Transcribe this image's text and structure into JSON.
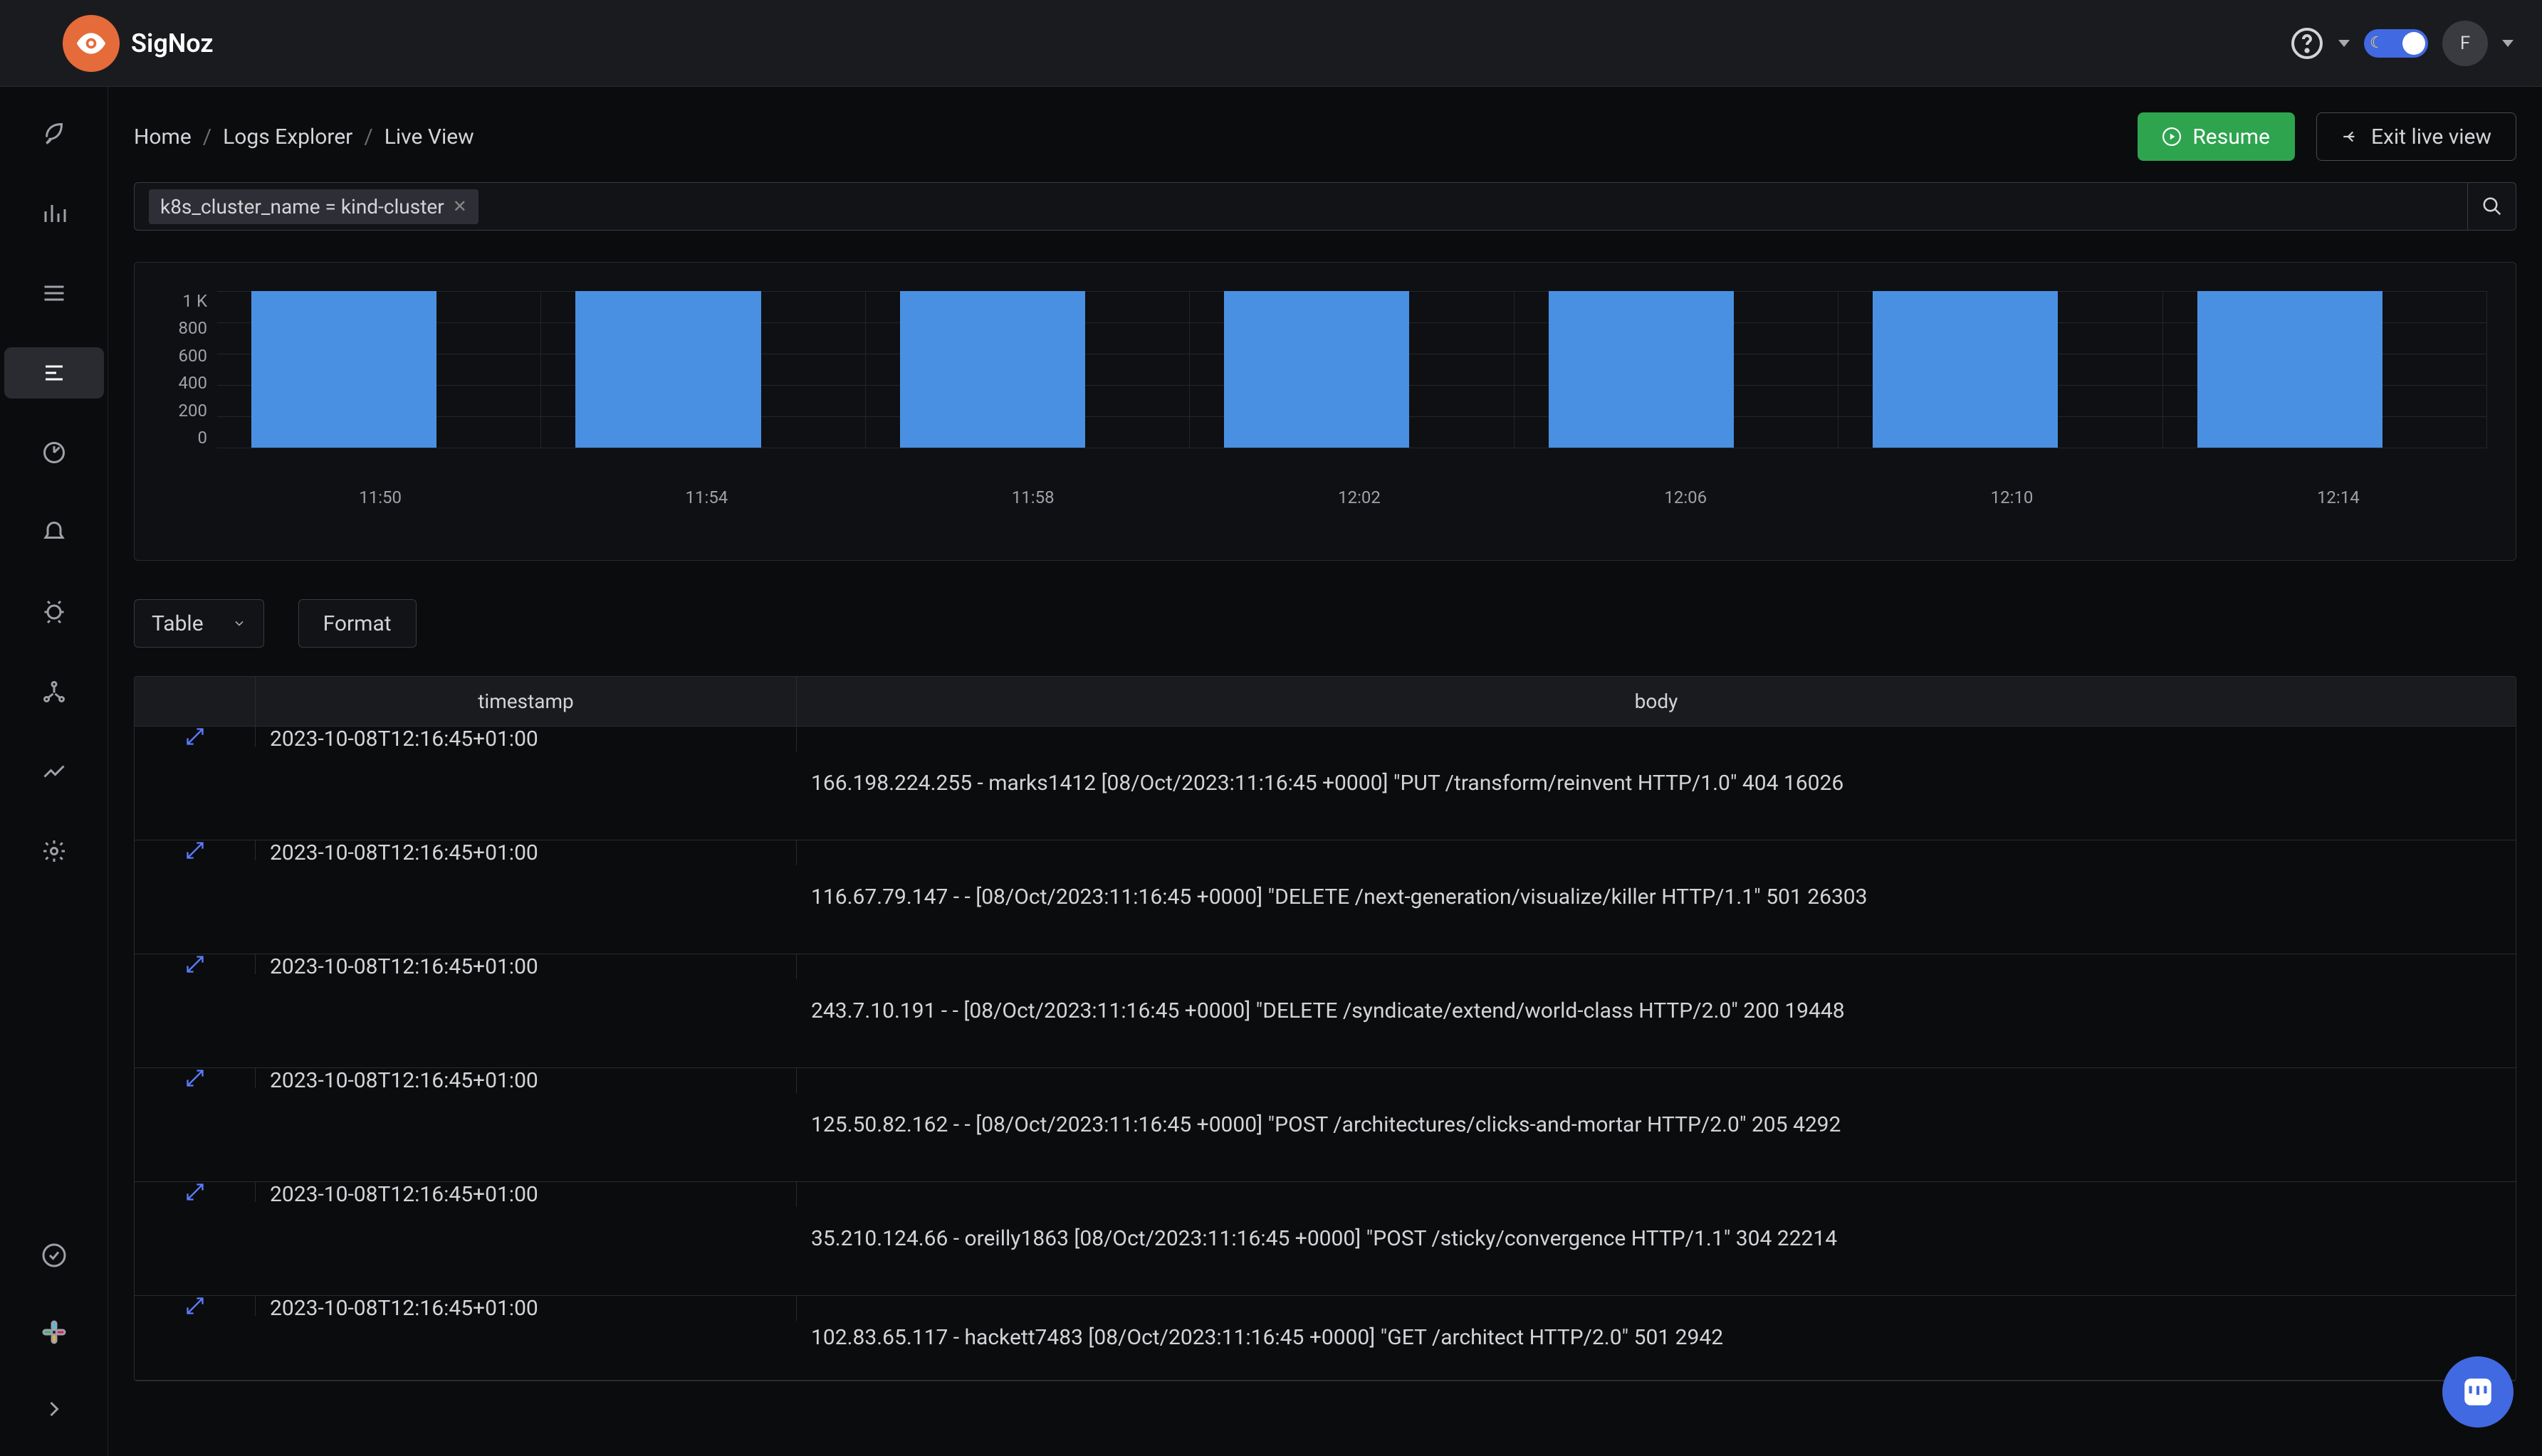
{
  "brand": "SigNoz",
  "top": {
    "avatar_initial": "F"
  },
  "breadcrumbs": [
    "Home",
    "Logs Explorer",
    "Live View"
  ],
  "buttons": {
    "resume": "Resume",
    "exit": "Exit live view"
  },
  "filter": {
    "chip": "k8s_cluster_name = kind-cluster"
  },
  "controls": {
    "view_mode": "Table",
    "format": "Format"
  },
  "table": {
    "col_timestamp": "timestamp",
    "col_body": "body"
  },
  "rows": [
    {
      "ts": "2023-10-08T12:16:45+01:00",
      "body": "166.198.224.255 - marks1412 [08/Oct/2023:11:16:45 +0000] \"PUT /transform/reinvent HTTP/1.0\" 404 16026"
    },
    {
      "ts": "2023-10-08T12:16:45+01:00",
      "body": "116.67.79.147 - - [08/Oct/2023:11:16:45 +0000] \"DELETE /next-generation/visualize/killer HTTP/1.1\" 501 26303"
    },
    {
      "ts": "2023-10-08T12:16:45+01:00",
      "body": "243.7.10.191 - - [08/Oct/2023:11:16:45 +0000] \"DELETE /syndicate/extend/world-class HTTP/2.0\" 200 19448"
    },
    {
      "ts": "2023-10-08T12:16:45+01:00",
      "body": "125.50.82.162 - - [08/Oct/2023:11:16:45 +0000] \"POST /architectures/clicks-and-mortar HTTP/2.0\" 205 4292"
    },
    {
      "ts": "2023-10-08T12:16:45+01:00",
      "body": "35.210.124.66 - oreilly1863 [08/Oct/2023:11:16:45 +0000] \"POST /sticky/convergence HTTP/1.1\" 304 22214"
    },
    {
      "ts": "2023-10-08T12:16:45+01:00",
      "body": "102.83.65.117 - hackett7483 [08/Oct/2023:11:16:45 +0000] \"GET /architect HTTP/2.0\" 501 2942"
    }
  ],
  "chart_data": {
    "type": "bar",
    "categories": [
      "11:50",
      "11:54",
      "11:58",
      "12:02",
      "12:06",
      "12:10",
      "12:14"
    ],
    "values": [
      1000,
      1000,
      1000,
      1000,
      1000,
      1000,
      1000
    ],
    "ylabel": "",
    "ylim": [
      0,
      1000
    ],
    "yticks": [
      "1 K",
      "800",
      "600",
      "400",
      "200",
      "0"
    ]
  }
}
